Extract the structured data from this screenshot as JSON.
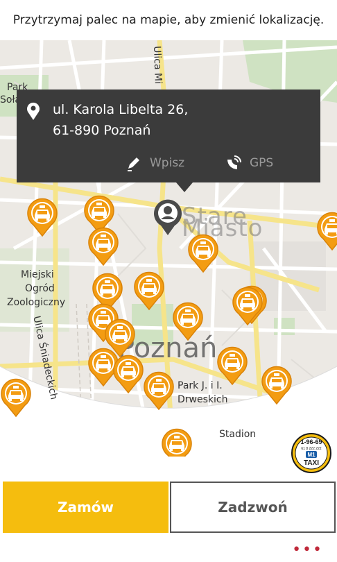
{
  "hint_text": "Przytrzymaj palec na mapie, aby zmienić lokalizację.",
  "address": {
    "line1": "ul. Karola Libelta 26,",
    "line2": "61-890 Poznań"
  },
  "actions": {
    "wpisz_label": "Wpisz",
    "gps_label": "GPS"
  },
  "map_labels": {
    "park": "Park",
    "park_sol": "Sołac",
    "stare_miasto": "Stare Miasto",
    "ulica_mi": "Ulica Mi",
    "ogrod_1": "Miejski",
    "ogrod_2": "Ogród",
    "ogrod_3": "Zoologiczny",
    "ulica_sniadeckich": "Ulica Śniadeckich",
    "city": "Poznań",
    "park_dreweskich_1": "Park J. i I.",
    "park_dreweskich_2": "Drweskich",
    "stadion": "Stadion"
  },
  "taxi_icon": "taxi-icon",
  "logo": {
    "phone": "1-96-69",
    "small": "61 8 222 222",
    "badge": "M1",
    "word": "TAXI"
  },
  "buttons": {
    "order_label": "Zamów",
    "call_label": "Zadzwoń"
  },
  "more_label": "•••",
  "colors": {
    "accent": "#f5bd0e",
    "taxi_orange": "#f39c12",
    "card": "#3b3b3b"
  }
}
